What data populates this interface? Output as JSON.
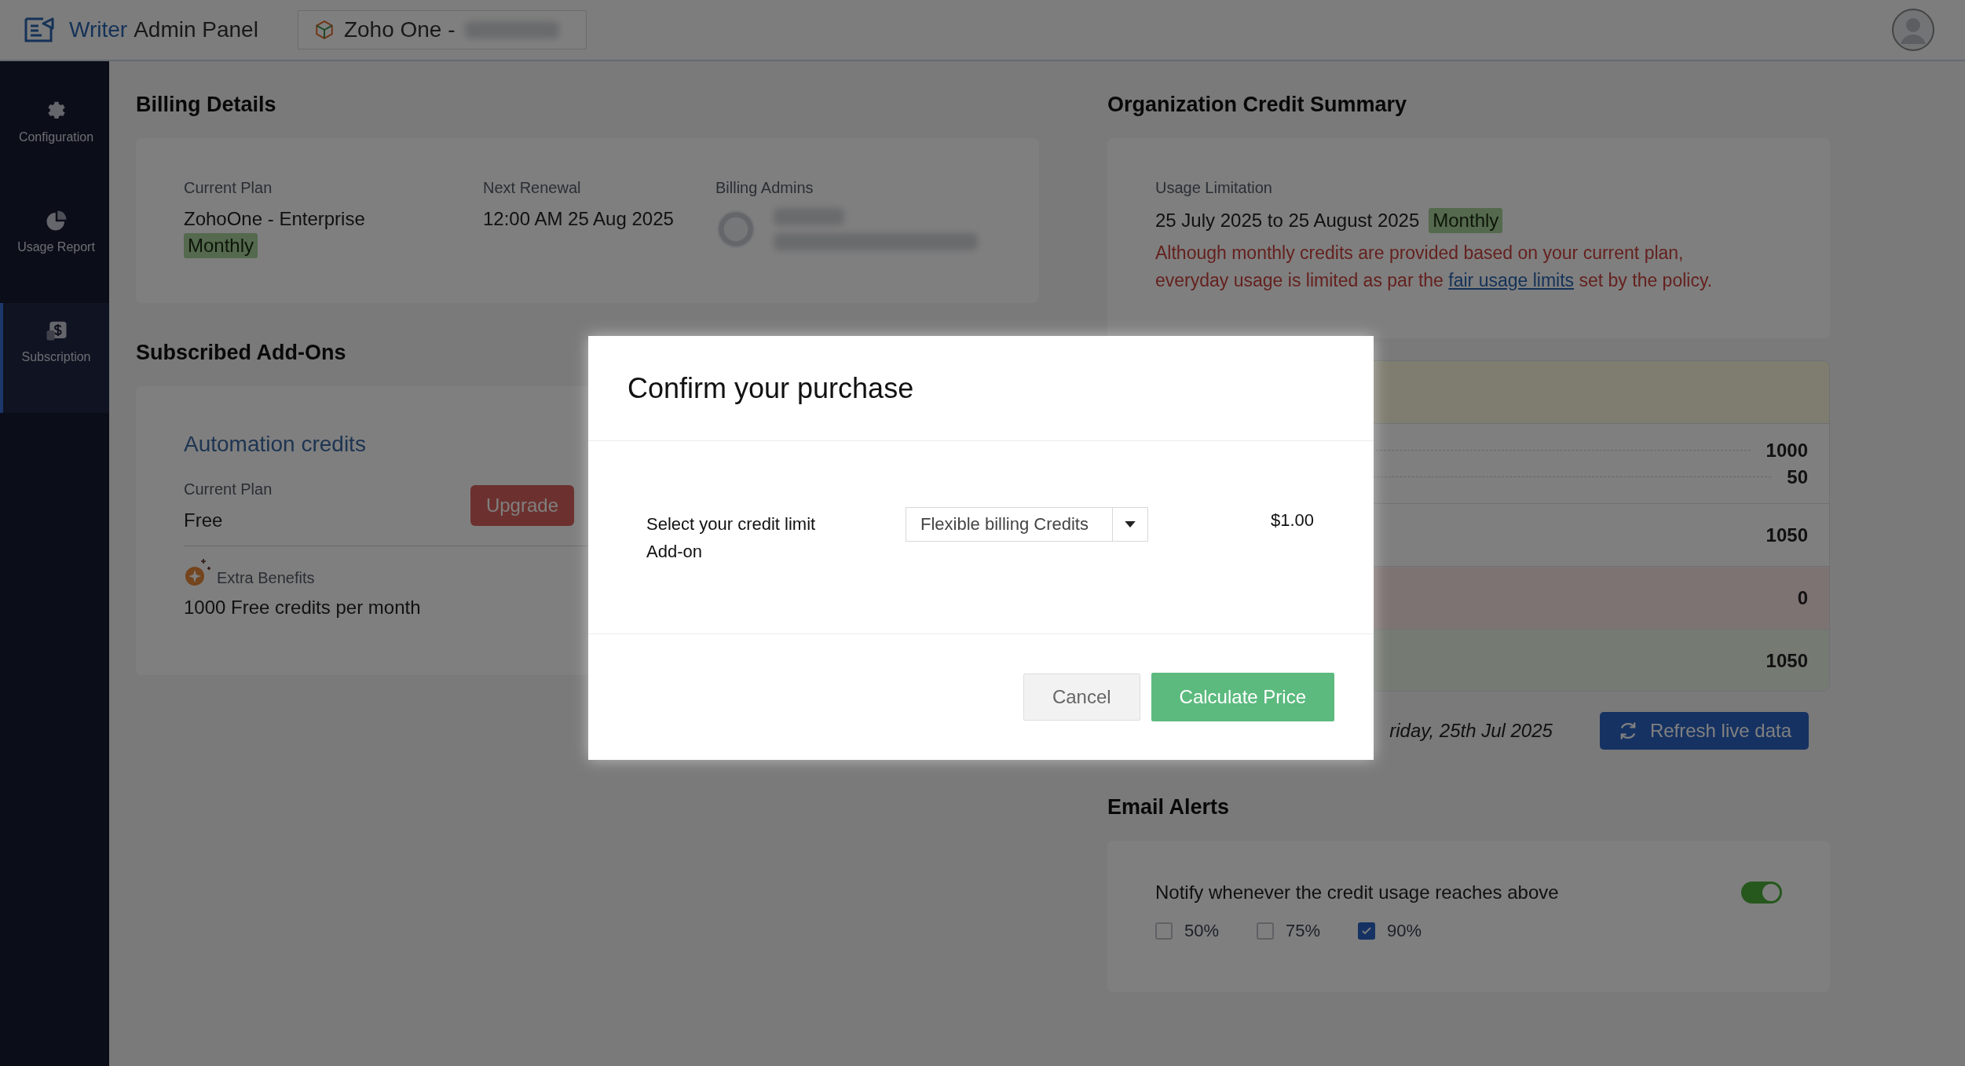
{
  "header": {
    "brand_accent": "Writer",
    "brand": "Admin Panel",
    "org_switcher": {
      "label": "Zoho One -"
    }
  },
  "sidebar": {
    "items": [
      {
        "label": "Configuration",
        "selected": false
      },
      {
        "label": "Usage Report",
        "selected": false
      },
      {
        "label": "Subscription",
        "selected": true
      }
    ]
  },
  "billing_details": {
    "title": "Billing Details",
    "current_plan": {
      "label": "Current Plan",
      "value": "ZohoOne - Enterprise",
      "badge": "Monthly"
    },
    "next_renewal": {
      "label": "Next Renewal",
      "value": "12:00 AM 25 Aug 2025"
    },
    "billing_admins": {
      "label": "Billing Admins"
    }
  },
  "subscribed_addons": {
    "title": "Subscribed Add-Ons",
    "addon": {
      "name": "Automation credits",
      "plan_label": "Current Plan",
      "plan_value": "Free",
      "upgrade_button": "Upgrade",
      "benefits_label": "Extra Benefits",
      "benefit": "1000 Free credits per month"
    }
  },
  "credit_summary": {
    "title": "Organization Credit Summary",
    "usage_label": "Usage Limitation",
    "period": "25 July 2025 to 25 August 2025",
    "badge": "Monthly",
    "notice": {
      "before": "Although monthly credits are provided based on your current plan, everyday usage is limited as par the",
      "link": "fair usage limits",
      "after": "set by the policy."
    }
  },
  "credit_table": {
    "rows": [
      {
        "kind": "banner"
      },
      {
        "kind": "list",
        "values": [
          "1000",
          "50"
        ]
      },
      {
        "kind": "plain",
        "values": [
          "1050"
        ]
      },
      {
        "kind": "negative",
        "values": [
          "0"
        ]
      },
      {
        "kind": "positive",
        "values": [
          "1050"
        ]
      }
    ],
    "last_updated": "riday, 25th Jul 2025",
    "refresh_button": "Refresh live data"
  },
  "email_alerts": {
    "title": "Email Alerts",
    "notify_text": "Notify whenever the credit usage reaches above",
    "enabled": true,
    "thresholds": [
      {
        "label": "50%",
        "checked": false
      },
      {
        "label": "75%",
        "checked": false
      },
      {
        "label": "90%",
        "checked": true
      }
    ]
  },
  "modal": {
    "title": "Confirm your purchase",
    "field_label": "Select your credit limit Add-on",
    "dropdown_value": "Flexible billing Credits",
    "price": "$1.00",
    "buttons": [
      {
        "label": "Cancel",
        "kind": "secondary"
      },
      {
        "label": "Calculate Price",
        "kind": "primary"
      }
    ]
  }
}
